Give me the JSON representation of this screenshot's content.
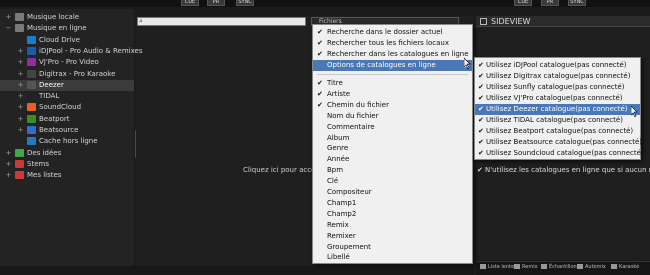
{
  "topbar": {
    "buttons": [
      "CUE",
      "PR",
      "SYNC",
      "CUE",
      "PR",
      "SYNC"
    ]
  },
  "tree": {
    "items": [
      {
        "label": "Musique locale",
        "expander": "+",
        "icon": "computer-icon",
        "color": "#7a7a7a"
      },
      {
        "label": "Musique en ligne",
        "expander": "-",
        "icon": "computer-icon",
        "color": "#7a7a7a"
      },
      {
        "label": "Cloud Drive",
        "expander": "",
        "icon": "cloud-icon",
        "color": "#1e7bc4"
      },
      {
        "label": "iDJPool - Pro Audio & Remixes",
        "expander": "+",
        "icon": "idjpool-icon",
        "color": "#1f5aa8"
      },
      {
        "label": "VJ'Pro - Pro Video",
        "expander": "+",
        "icon": "vjpro-icon",
        "color": "#8a2ea0"
      },
      {
        "label": "Digitrax - Pro Karaoke",
        "expander": "+",
        "icon": "digitrax-icon",
        "color": "#444444"
      },
      {
        "label": "Deezer",
        "expander": "+",
        "icon": "deezer-icon",
        "color": "#555555"
      },
      {
        "label": "TIDAL",
        "expander": "+",
        "icon": "tidal-icon",
        "color": "#222222"
      },
      {
        "label": "SoundCloud",
        "expander": "+",
        "icon": "soundcloud-icon",
        "color": "#e8631c"
      },
      {
        "label": "Beatport",
        "expander": "+",
        "icon": "beatport-icon",
        "color": "#3a8e2a"
      },
      {
        "label": "Beatsource",
        "expander": "+",
        "icon": "beatsource-icon",
        "color": "#2b6fd1"
      },
      {
        "label": "Cache hors ligne",
        "expander": "",
        "icon": "cache-icon",
        "color": "#1e7bc4"
      },
      {
        "label": "Des idées",
        "expander": "+",
        "icon": "ideas-icon",
        "color": "#3fa84a"
      },
      {
        "label": "Stems",
        "expander": "+",
        "icon": "stems-icon",
        "color": "#c93a3a"
      },
      {
        "label": "Mes listes",
        "expander": "+",
        "icon": "lists-icon",
        "color": "#c93a3a"
      }
    ]
  },
  "center": {
    "fields_button": "Fichiers",
    "message": "Cliquez ici pour accéd"
  },
  "menu": {
    "search_options": [
      {
        "label": "Recherche dans le dossier actuel",
        "checked": true
      },
      {
        "label": "Rechercher tous les fichiers locaux",
        "checked": true
      },
      {
        "label": "Rechercher dans les catalogues en ligne",
        "checked": true
      },
      {
        "label": "Options de catalogues en ligne",
        "checked": false,
        "submenu": true,
        "highlighted": true
      }
    ],
    "fields": [
      {
        "label": "Titre",
        "checked": true
      },
      {
        "label": "Artiste",
        "checked": true
      },
      {
        "label": "Chemin du fichier",
        "checked": true
      },
      {
        "label": "Nom du fichier",
        "checked": false
      },
      {
        "label": "Commentaire",
        "checked": false
      },
      {
        "label": "Album",
        "checked": false
      },
      {
        "label": "Genre",
        "checked": false
      },
      {
        "label": "Année",
        "checked": false
      },
      {
        "label": "Bpm",
        "checked": false
      },
      {
        "label": "Clé",
        "checked": false
      },
      {
        "label": "Compositeur",
        "checked": false
      },
      {
        "label": "Champ1",
        "checked": false
      },
      {
        "label": "Champ2",
        "checked": false
      },
      {
        "label": "Remix",
        "checked": false
      },
      {
        "label": "Remixer",
        "checked": false
      },
      {
        "label": "Groupement",
        "checked": false
      },
      {
        "label": "Libellé",
        "checked": false
      }
    ]
  },
  "sideview": {
    "title": "SIDEVIEW"
  },
  "submenu": {
    "items": [
      {
        "label": "Utilisez iDJPool catalogue(pas connecté)",
        "checked": true
      },
      {
        "label": "Utilisez Digitrax catalogue(pas connecté)",
        "checked": true
      },
      {
        "label": "Utilisez Sunfly catalogue(pas connecté)",
        "checked": true
      },
      {
        "label": "Utilisez VJ'Pro catalogue(pas connecté)",
        "checked": true
      },
      {
        "label": "Utilisez Deezer catalogue(pas connecté)",
        "checked": true,
        "highlighted": true
      },
      {
        "label": "Utilisez TIDAL catalogue(pas connecté)",
        "checked": true
      },
      {
        "label": "Utilisez Beatport catalogue(pas connecté)",
        "checked": true
      },
      {
        "label": "Utilisez Beatsource catalogue(pas connecté)",
        "checked": true
      },
      {
        "label": "Utilisez Soundcloud catalogue(pas connecté)",
        "checked": true
      }
    ],
    "offline_option": {
      "label": "N'utilisez les catalogues en ligne que si aucun résu",
      "checked": true
    }
  },
  "bottombar": {
    "buttons": [
      {
        "label": "Liste lente",
        "icon": "list-icon"
      },
      {
        "label": "Remix",
        "icon": "remix-icon"
      },
      {
        "label": "Échantillon",
        "icon": "sampler-icon"
      },
      {
        "label": "Automix",
        "icon": "automix-icon"
      },
      {
        "label": "Karaoké",
        "icon": "karaoke-icon"
      }
    ]
  }
}
